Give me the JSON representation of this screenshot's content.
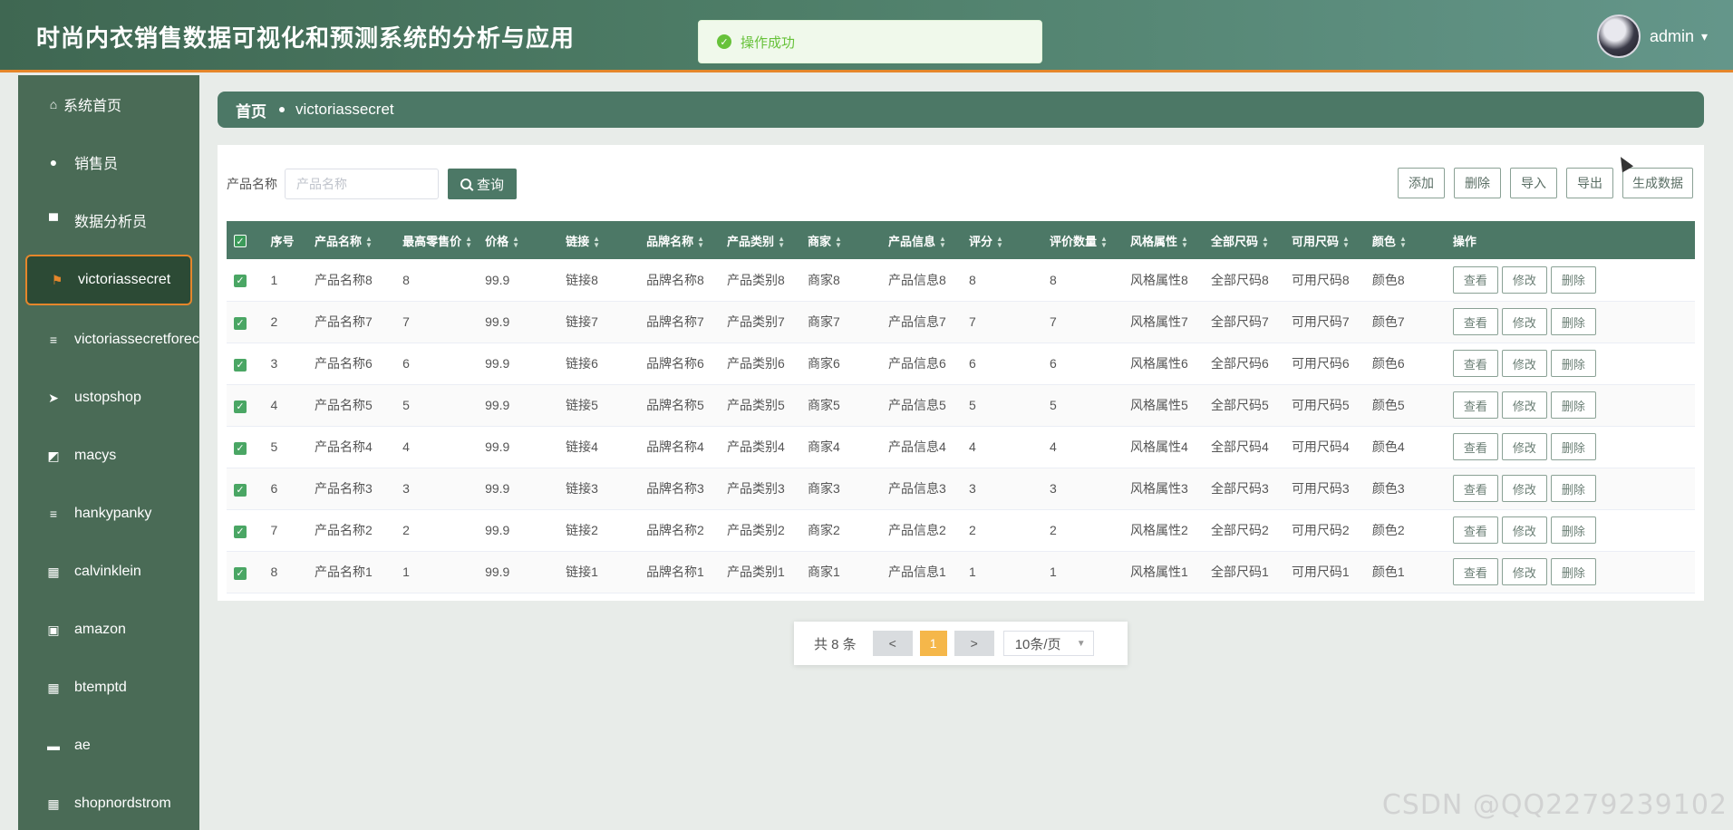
{
  "app": {
    "title": "时尚内衣销售数据可视化和预测系统的分析与应用"
  },
  "toast": {
    "message": "操作成功"
  },
  "user": {
    "name": "admin"
  },
  "sidebar": {
    "items": [
      {
        "label": "系统首页",
        "icon": "home-icon"
      },
      {
        "label": "销售员",
        "icon": "user-icon"
      },
      {
        "label": "数据分析员",
        "icon": "podium-icon"
      },
      {
        "label": "victoriassecret",
        "icon": "flag-icon"
      },
      {
        "label": "victoriassecretforec",
        "icon": "list-icon"
      },
      {
        "label": "ustopshop",
        "icon": "send-icon"
      },
      {
        "label": "macys",
        "icon": "chart-icon"
      },
      {
        "label": "hankypanky",
        "icon": "list-icon"
      },
      {
        "label": "calvinklein",
        "icon": "grid-icon"
      },
      {
        "label": "amazon",
        "icon": "box-icon"
      },
      {
        "label": "btemptd",
        "icon": "grid-icon"
      },
      {
        "label": "ae",
        "icon": "ticket-icon"
      },
      {
        "label": "shopnordstrom",
        "icon": "grid-icon"
      }
    ]
  },
  "breadcrumb": {
    "home": "首页",
    "current": "victoriassecret"
  },
  "search": {
    "label": "产品名称",
    "placeholder": "产品名称",
    "value": "",
    "button": "查询"
  },
  "toolbar": {
    "add": "添加",
    "delete": "删除",
    "import": "导入",
    "export": "导出",
    "generate": "生成数据"
  },
  "table": {
    "columns": [
      "序号",
      "产品名称",
      "最高零售价",
      "价格",
      "链接",
      "品牌名称",
      "产品类别",
      "商家",
      "产品信息",
      "评分",
      "评价数量",
      "风格属性",
      "全部尺码",
      "可用尺码",
      "颜色",
      "操作"
    ],
    "rows": [
      [
        "1",
        "产品名称8",
        "8",
        "99.9",
        "链接8",
        "品牌名称8",
        "产品类别8",
        "商家8",
        "产品信息8",
        "8",
        "8",
        "风格属性8",
        "全部尺码8",
        "可用尺码8",
        "颜色8"
      ],
      [
        "2",
        "产品名称7",
        "7",
        "99.9",
        "链接7",
        "品牌名称7",
        "产品类别7",
        "商家7",
        "产品信息7",
        "7",
        "7",
        "风格属性7",
        "全部尺码7",
        "可用尺码7",
        "颜色7"
      ],
      [
        "3",
        "产品名称6",
        "6",
        "99.9",
        "链接6",
        "品牌名称6",
        "产品类别6",
        "商家6",
        "产品信息6",
        "6",
        "6",
        "风格属性6",
        "全部尺码6",
        "可用尺码6",
        "颜色6"
      ],
      [
        "4",
        "产品名称5",
        "5",
        "99.9",
        "链接5",
        "品牌名称5",
        "产品类别5",
        "商家5",
        "产品信息5",
        "5",
        "5",
        "风格属性5",
        "全部尺码5",
        "可用尺码5",
        "颜色5"
      ],
      [
        "5",
        "产品名称4",
        "4",
        "99.9",
        "链接4",
        "品牌名称4",
        "产品类别4",
        "商家4",
        "产品信息4",
        "4",
        "4",
        "风格属性4",
        "全部尺码4",
        "可用尺码4",
        "颜色4"
      ],
      [
        "6",
        "产品名称3",
        "3",
        "99.9",
        "链接3",
        "品牌名称3",
        "产品类别3",
        "商家3",
        "产品信息3",
        "3",
        "3",
        "风格属性3",
        "全部尺码3",
        "可用尺码3",
        "颜色3"
      ],
      [
        "7",
        "产品名称2",
        "2",
        "99.9",
        "链接2",
        "品牌名称2",
        "产品类别2",
        "商家2",
        "产品信息2",
        "2",
        "2",
        "风格属性2",
        "全部尺码2",
        "可用尺码2",
        "颜色2"
      ],
      [
        "8",
        "产品名称1",
        "1",
        "99.9",
        "链接1",
        "品牌名称1",
        "产品类别1",
        "商家1",
        "产品信息1",
        "1",
        "1",
        "风格属性1",
        "全部尺码1",
        "可用尺码1",
        "颜色1"
      ]
    ],
    "actions": {
      "view": "查看",
      "edit": "修改",
      "delete": "删除"
    }
  },
  "pagination": {
    "total_text": "共 8 条",
    "prev": "<",
    "current": "1",
    "next": ">",
    "page_size": "10条/页"
  },
  "watermark": "CSDN @QQ2279239102",
  "colors": {
    "primary": "#4c7866",
    "accent": "#e5862b",
    "sidebar": "#4a6b56",
    "success": "#67c23a"
  }
}
